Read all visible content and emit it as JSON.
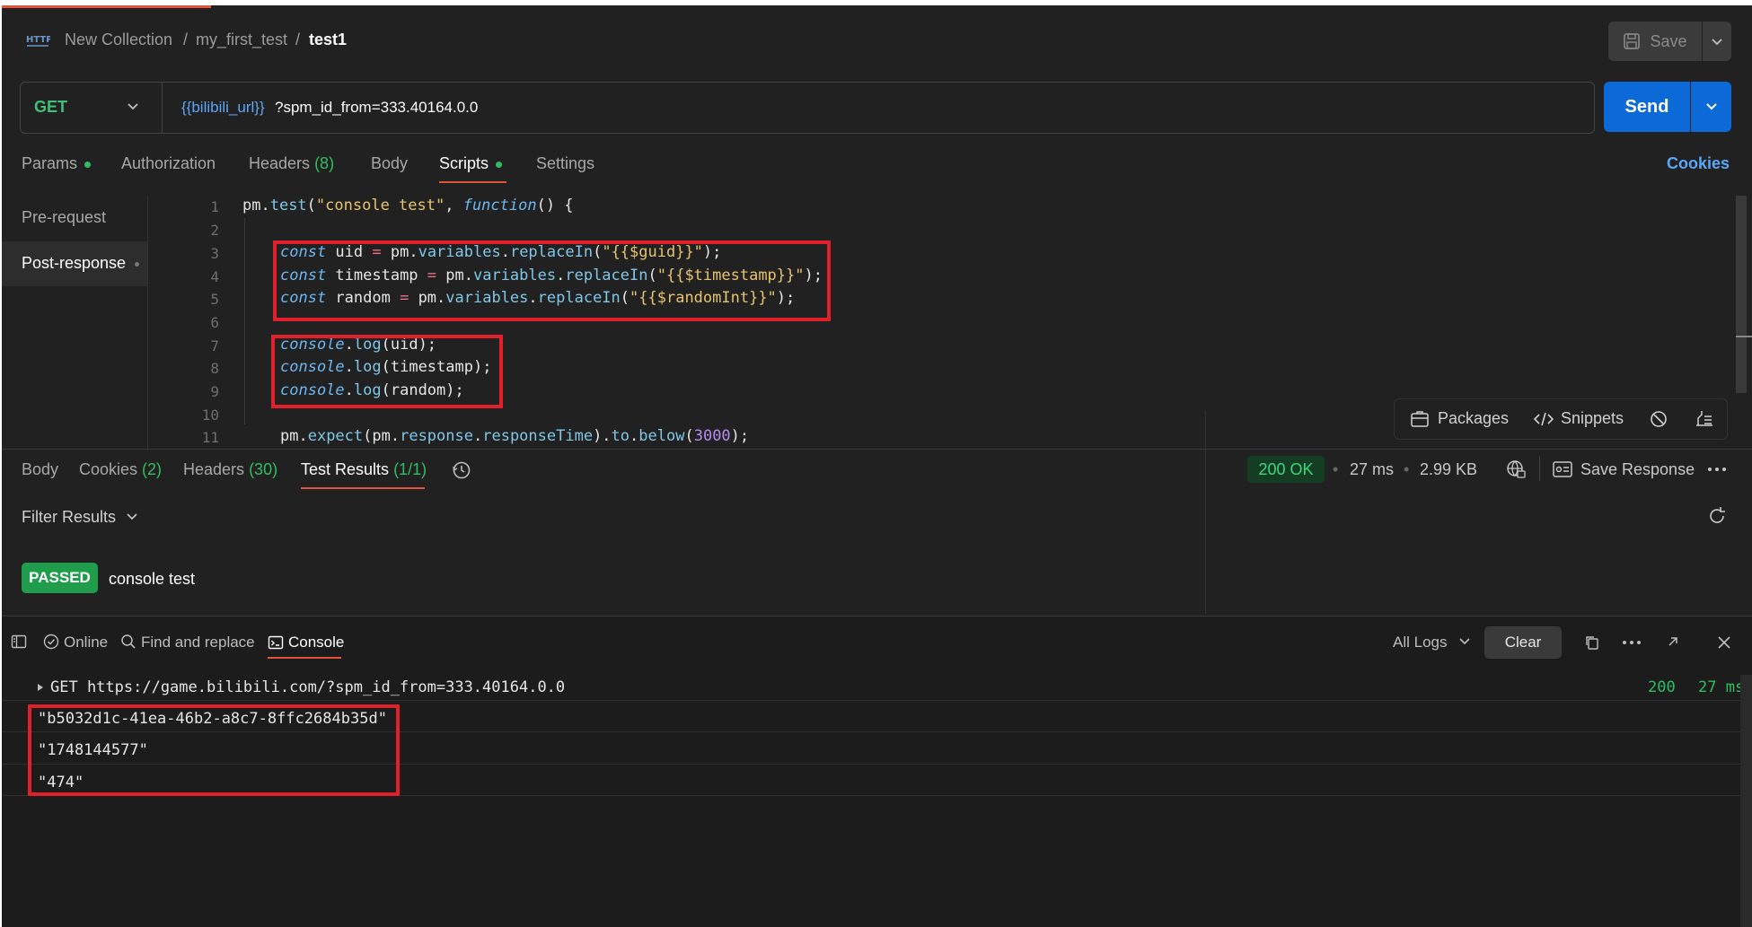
{
  "header": {
    "http_icon": "http-icon",
    "breadcrumb": [
      "New Collection",
      "my_first_test",
      "test1"
    ],
    "separator": "/",
    "save_label": "Save"
  },
  "request": {
    "method": "GET",
    "url_variable": "{{bilibili_url}}",
    "url_rest": "?spm_id_from=333.40164.0.0",
    "send_label": "Send"
  },
  "request_tabs": {
    "params": "Params",
    "authorization": "Authorization",
    "headers": "Headers",
    "headers_count": "(8)",
    "body": "Body",
    "scripts": "Scripts",
    "settings": "Settings",
    "cookies": "Cookies",
    "active": "Scripts"
  },
  "scripts_menu": {
    "pre_request": "Pre-request",
    "post_response": "Post-response",
    "active": "Post-response"
  },
  "code": {
    "line_numbers": [
      "1",
      "2",
      "3",
      "4",
      "5",
      "6",
      "7",
      "8",
      "9",
      "10",
      "11"
    ],
    "lines": [
      "pm.test(\"console test\", function() {",
      "",
      "const uid = pm.variables.replaceIn(\"{{$guid}}\");",
      "const timestamp = pm.variables.replaceIn(\"{{$timestamp}}\");",
      "const random = pm.variables.replaceIn(\"{{$randomInt}}\");",
      "",
      "console.log(uid);",
      "console.log(timestamp);",
      "console.log(random);",
      "",
      "pm.expect(pm.response.responseTime).to.below(3000);"
    ]
  },
  "editor_toolbar": {
    "packages": "Packages",
    "snippets": "Snippets"
  },
  "response_tabs": {
    "body": "Body",
    "cookies": "Cookies",
    "cookies_count": "(2)",
    "headers": "Headers",
    "headers_count": "(30)",
    "test_results": "Test Results",
    "test_results_count": "(1/1)",
    "active": "Test Results"
  },
  "response_meta": {
    "status": "200 OK",
    "time": "27 ms",
    "size": "2.99 KB",
    "save_response": "Save Response",
    "status_color": "#3fd67a"
  },
  "test_results": {
    "filter_label": "Filter Results",
    "items": [
      {
        "status": "PASSED",
        "name": "console test"
      }
    ]
  },
  "console_bar": {
    "online": "Online",
    "find_replace": "Find and replace",
    "console": "Console",
    "all_logs": "All Logs",
    "clear": "Clear"
  },
  "console": {
    "request_log": "GET https://game.bilibili.com/?spm_id_from=333.40164.0.0",
    "request_status": "200",
    "request_time": "27 ms",
    "logs": [
      "\"b5032d1c-41ea-46b2-a8c7-8ffc2684b35d\"",
      "\"1748144577\"",
      "\"474\""
    ]
  },
  "colors": {
    "accent": "#e0533d",
    "send_button": "#0c6ad8",
    "get_method": "#3fbf78",
    "highlight_box": "#e0202a"
  }
}
